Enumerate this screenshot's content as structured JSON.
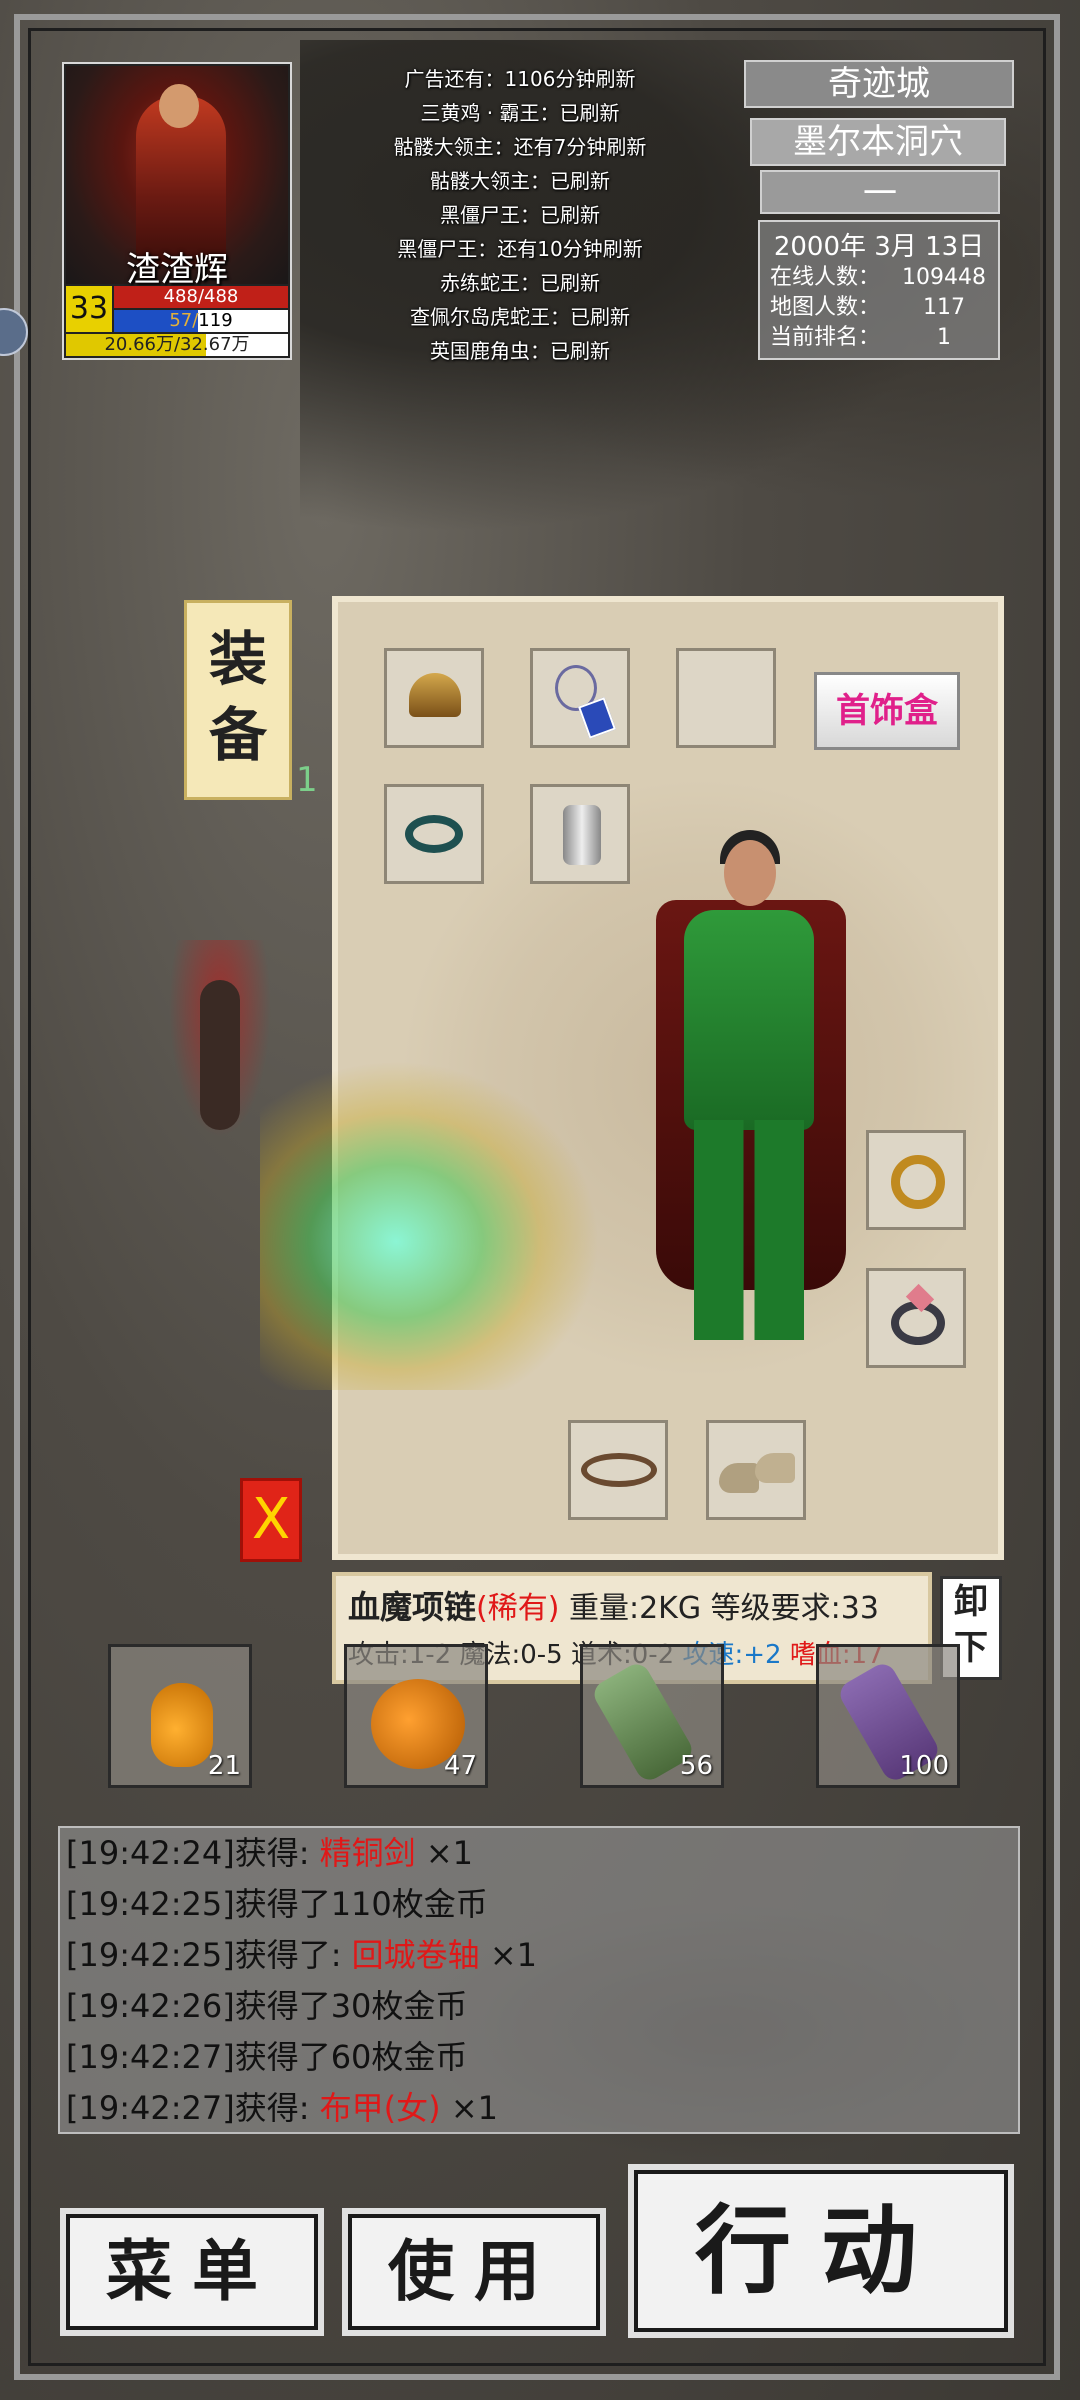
{
  "player": {
    "name": "渣渣辉",
    "level": "33",
    "hp_text": "488/488",
    "mp_text": "57/119",
    "mp_fraction": 0.48,
    "exp_text": "20.66万/32.67万",
    "exp_fraction": 0.63
  },
  "boss_timers": [
    "广告还有：1106分钟刷新",
    "三黄鸡 · 霸王：已刷新",
    "骷髅大领主：还有7分钟刷新",
    "骷髅大领主：已刷新",
    "黑僵尸王：已刷新",
    "黑僵尸王：还有10分钟刷新",
    "赤练蛇王：已刷新",
    "查佩尔岛虎蛇王：已刷新",
    "英国鹿角虫：已刷新"
  ],
  "location": {
    "city": "奇迹城",
    "area": "墨尔本洞穴",
    "floor": "一",
    "date": "2000年 3月 13日",
    "online_label": "在线人数：",
    "online_value": "109448",
    "map_label": "地图人数：",
    "map_value": "117",
    "rank_label": "当前排名：",
    "rank_value": "1"
  },
  "equipment": {
    "tag": "装备",
    "jewel_box": "首饰盒",
    "close": "X",
    "unequip": "卸下",
    "slots": [
      "helmet-icon",
      "necklace-icon",
      "bracelet-icon",
      "armband-icon",
      "dragon-ring-icon",
      "gem-ring-icon",
      "belt-icon",
      "boots-icon"
    ]
  },
  "item_info": {
    "name": "血魔项链",
    "rarity": "(稀有)",
    "weight": "重量:2KG",
    "req": "等级要求:33",
    "stats": "攻击:1-2 魔法:0-5 道术:0-2",
    "speed": "攻速:+2",
    "lifesteal": "嗜血:17"
  },
  "consumables": [
    {
      "icon": "small-potion-icon",
      "count": "21"
    },
    {
      "icon": "large-potion-icon",
      "count": "47"
    },
    {
      "icon": "scroll-green-icon",
      "count": "56"
    },
    {
      "icon": "scroll-purple-icon",
      "count": "100"
    }
  ],
  "log": [
    {
      "pre": "[19:42:24]获得: ",
      "item": "精铜剑",
      "post": " ×1"
    },
    {
      "pre": "[19:42:25]获得了110枚金币",
      "item": "",
      "post": ""
    },
    {
      "pre": "[19:42:25]获得了: ",
      "item": "回城卷轴",
      "post": " ×1"
    },
    {
      "pre": "[19:42:26]获得了30枚金币",
      "item": "",
      "post": ""
    },
    {
      "pre": "[19:42:27]获得了60枚金币",
      "item": "",
      "post": ""
    },
    {
      "pre": "[19:42:27]获得: ",
      "item": "布甲(女)",
      "post": " ×1"
    }
  ],
  "buttons": {
    "menu": "菜单",
    "use": "使用",
    "action": "行动"
  }
}
